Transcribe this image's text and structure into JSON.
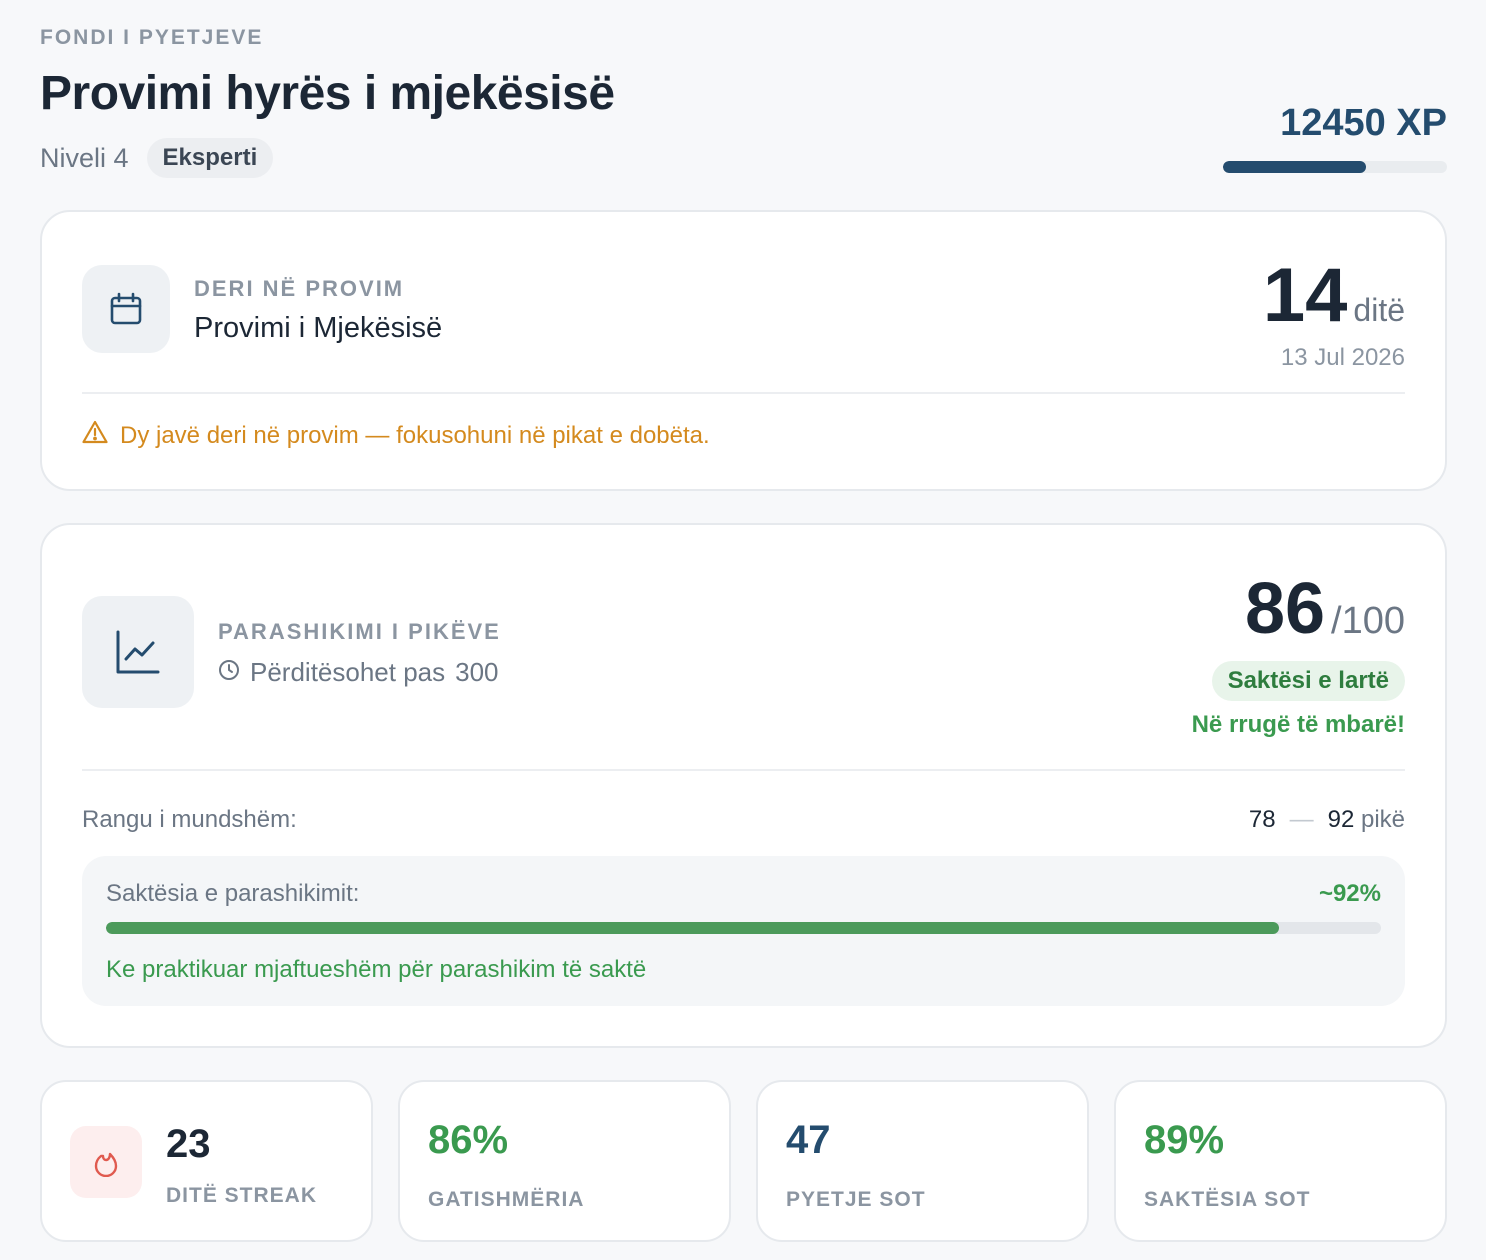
{
  "header": {
    "eyebrow": "FONDI I PYETJEVE",
    "title": "Provimi hyrës i mjekësisë",
    "level_text": "Niveli 4",
    "level_badge": "Eksperti",
    "xp_label": "12450 XP",
    "xp_progress_percent": 64
  },
  "exam_card": {
    "icon": "calendar-icon",
    "label": "DERI NË PROVIM",
    "exam_name": "Provimi i Mjekësisë",
    "days_count": "14",
    "days_unit": "ditë",
    "exam_date": "13 Jul 2026",
    "warning_icon": "warning-triangle-icon",
    "warning_text": "Dy javë deri në provim — fokusohuni në pikat e dobëta."
  },
  "prediction_card": {
    "icon": "trend-chart-icon",
    "label": "PARASHIKIMI I PIKËVE",
    "update_icon": "clock-icon",
    "update_text": "Përditësohet pas",
    "update_value": "300",
    "score": "86",
    "score_max": "/100",
    "accuracy_badge": "Saktësi e lartë",
    "on_track_text": "Në rrugë të mbarë!",
    "range_label": "Rangu i mundshëm:",
    "range_low": "78",
    "range_dash": "—",
    "range_high": "92",
    "range_unit": "pikë",
    "accuracy_label": "Saktësia e parashikimit:",
    "accuracy_value": "~92%",
    "accuracy_progress_percent": 92,
    "accuracy_note": "Ke praktikuar mjaftueshëm për parashikim të saktë"
  },
  "stats": [
    {
      "value": "23",
      "label": "DITË STREAK",
      "icon": "flame-icon",
      "color": "#1c2735"
    },
    {
      "value": "86%",
      "label": "GATISHMËRIA",
      "color": "#3a9a4f"
    },
    {
      "value": "47",
      "label": "PYETJE SOT",
      "color": "#244c6e"
    },
    {
      "value": "89%",
      "label": "SAKTËSIA SOT",
      "color": "#3a9a4f"
    }
  ],
  "colors": {
    "primary": "#244c6e",
    "success": "#3a9a4f",
    "warning": "#d48a1e",
    "danger": "#e05a4f"
  }
}
